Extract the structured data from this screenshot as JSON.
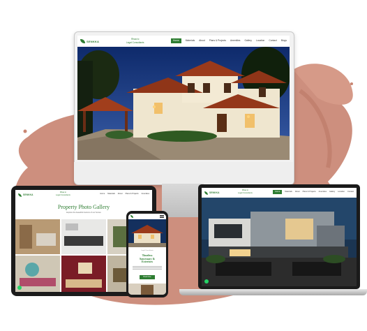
{
  "brand": {
    "name": "SENKKA",
    "tagline_line1": "Rhaa to",
    "tagline_line2": "Legal Consultants"
  },
  "desktop": {
    "nav_items": [
      "Home",
      "Materials",
      "About",
      "Plans & Projects",
      "Amenities",
      "Gallery",
      "Location",
      "Contact",
      "Blogs"
    ],
    "active_index": 0
  },
  "tablet": {
    "nav_items": [
      "Home",
      "Materials",
      "About",
      "Plans & Projects",
      "Amenities"
    ],
    "gallery_title": "Property Photo Gallery",
    "gallery_subtitle": "Explore the beautiful interiors of our homes"
  },
  "phone": {
    "heading_line1": "Timeless",
    "heading_line2": "Sanctuary &",
    "heading_line3": "Exteriors",
    "cta": "Book Now"
  },
  "laptop": {
    "nav_items": [
      "Home",
      "Materials",
      "About",
      "Plans & Projects",
      "Amenities",
      "Gallery",
      "Location",
      "Contact"
    ],
    "active_index": 0
  },
  "colors": {
    "brand_green": "#2e7d32",
    "splash": "#c98673",
    "wall": "#f4f1ea"
  }
}
